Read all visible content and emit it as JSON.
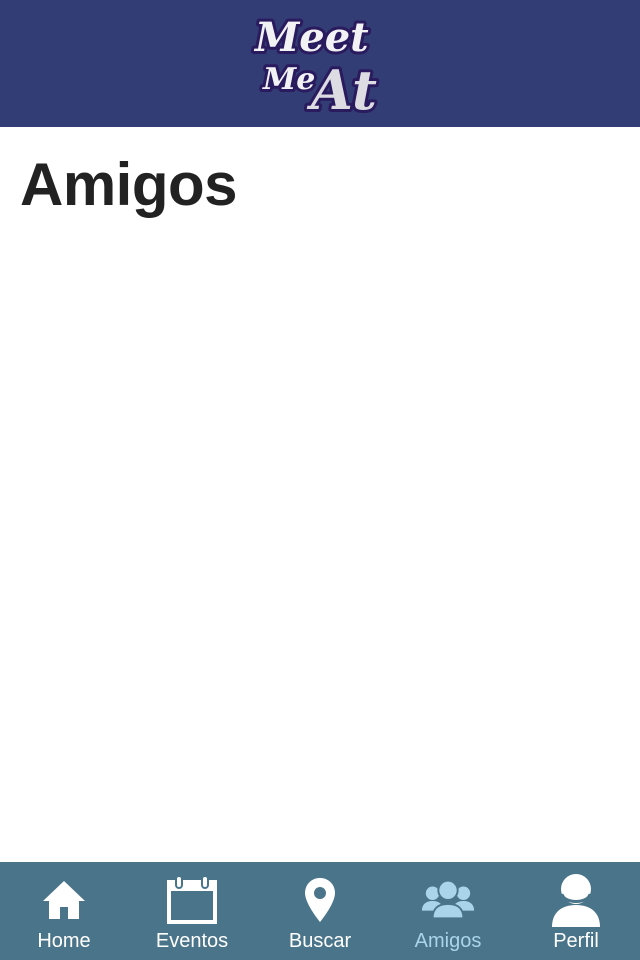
{
  "header": {
    "logo_text": [
      "Meet",
      "Me",
      "At"
    ],
    "background_color": "#333d75"
  },
  "page": {
    "title": "Amigos"
  },
  "tabbar": {
    "background_color": "#4a7489",
    "active_color": "#a9d4ea",
    "inactive_color": "#ffffff",
    "tabs": [
      {
        "label": "Home",
        "icon": "home-icon",
        "active": false
      },
      {
        "label": "Eventos",
        "icon": "calendar-icon",
        "active": false
      },
      {
        "label": "Buscar",
        "icon": "map-pin-icon",
        "active": false
      },
      {
        "label": "Amigos",
        "icon": "friends-icon",
        "active": true
      },
      {
        "label": "Perfil",
        "icon": "user-icon",
        "active": false
      }
    ]
  }
}
